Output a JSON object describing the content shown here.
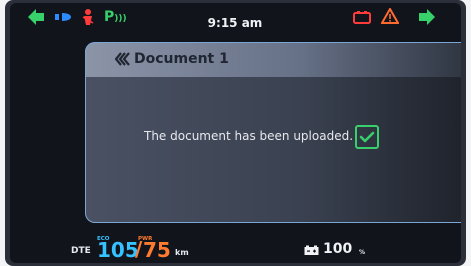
{
  "status_bar": {
    "time": "9:15 am",
    "icons": [
      "left-turn-signal-icon",
      "headlight-icon",
      "seatbelt-icon",
      "parking-assist-icon",
      "battery-warning-icon",
      "warning-triangle-icon",
      "right-turn-signal-icon"
    ],
    "parking_label": "P"
  },
  "dialog": {
    "title": "Document 1",
    "message": "The document has been uploaded.",
    "checkbox_checked": true,
    "colors": {
      "check": "#37d06a",
      "border": "#7aa6d6"
    }
  },
  "bottom_bar": {
    "dte_label": "DTE",
    "eco_label": "ECO",
    "eco_value": "105",
    "pwr_label": "PWR",
    "pwr_value": "75",
    "distance_unit": "km",
    "battery_value": "100",
    "battery_unit": "%"
  },
  "colors": {
    "turn_signal": "#37d06a",
    "eco": "#36c2ff",
    "pwr": "#ff7b2f",
    "warning": "#ff3b3b"
  }
}
